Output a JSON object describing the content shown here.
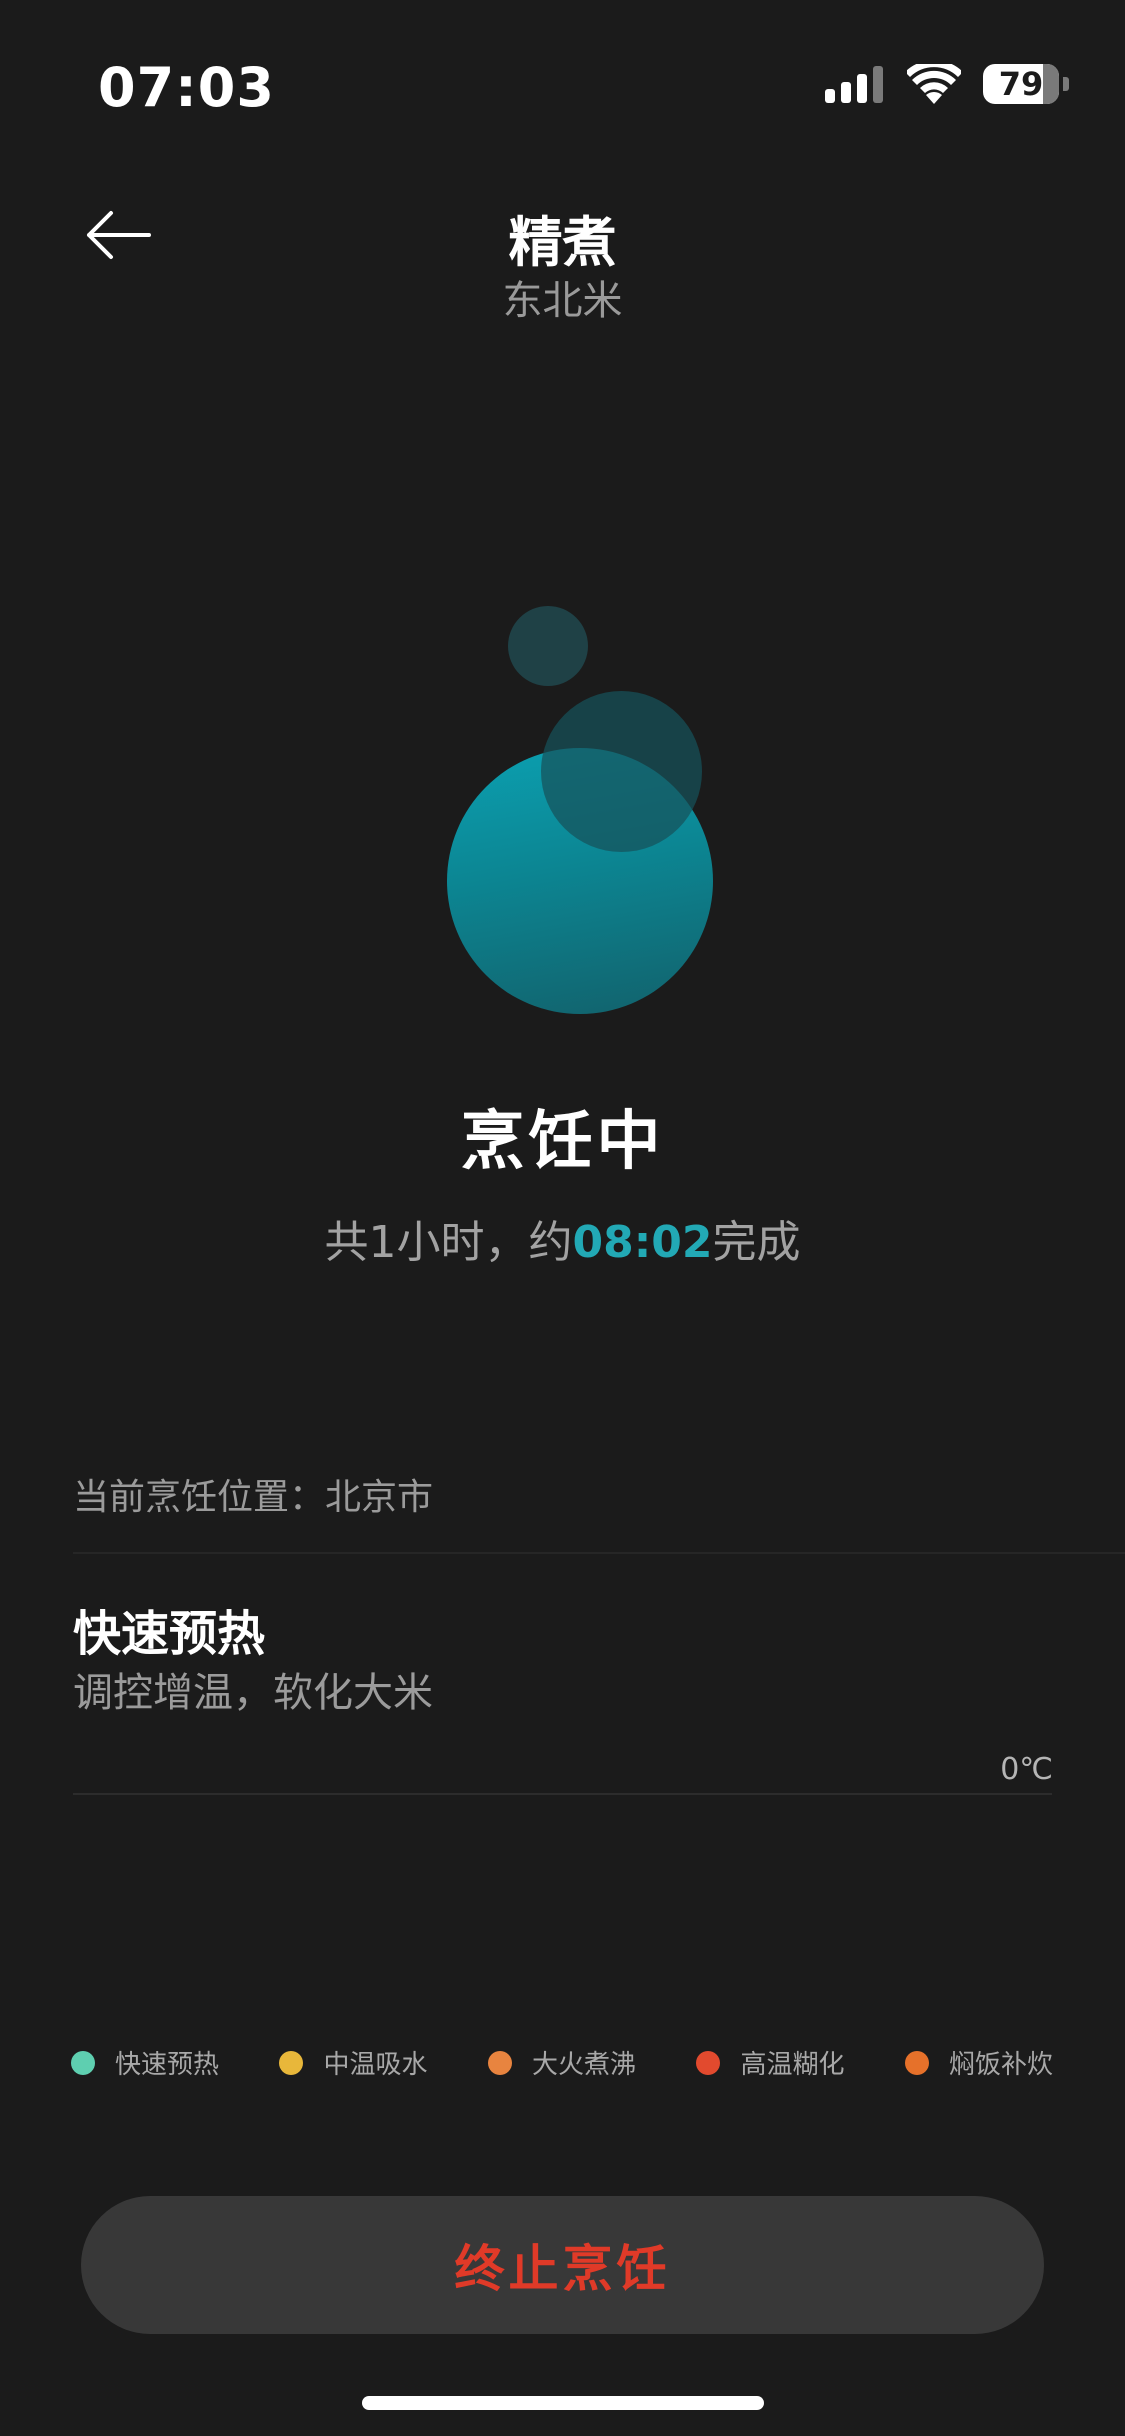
{
  "status_bar": {
    "time": "07:03",
    "battery_level": "79",
    "battery_fraction": 0.79,
    "signal_icon": "cellular-signal-icon",
    "wifi_icon": "wifi-icon"
  },
  "header": {
    "back_icon": "arrow-left-icon",
    "title": "精煮",
    "subtitle": "东北米"
  },
  "status": {
    "title": "烹饪中",
    "time_prefix": "共1小时，约",
    "finish_time": "08:02",
    "time_suffix": "完成"
  },
  "location": {
    "text": "当前烹饪位置：北京市"
  },
  "stage": {
    "title": "快速预热",
    "description": "调控增温，软化大米",
    "temperature": "0℃"
  },
  "legend": [
    {
      "label": "快速预热",
      "color": "#5ecfb0"
    },
    {
      "label": "中温吸水",
      "color": "#e8b73a"
    },
    {
      "label": "大火煮沸",
      "color": "#e8843f"
    },
    {
      "label": "高温糊化",
      "color": "#e24a2e"
    },
    {
      "label": "焖饭补炊",
      "color": "#e6712a"
    }
  ],
  "actions": {
    "stop_label": "终止烹饪",
    "stop_color": "#e03a28"
  },
  "colors": {
    "background": "#1b1b1b",
    "accent": "#22a9b5"
  }
}
